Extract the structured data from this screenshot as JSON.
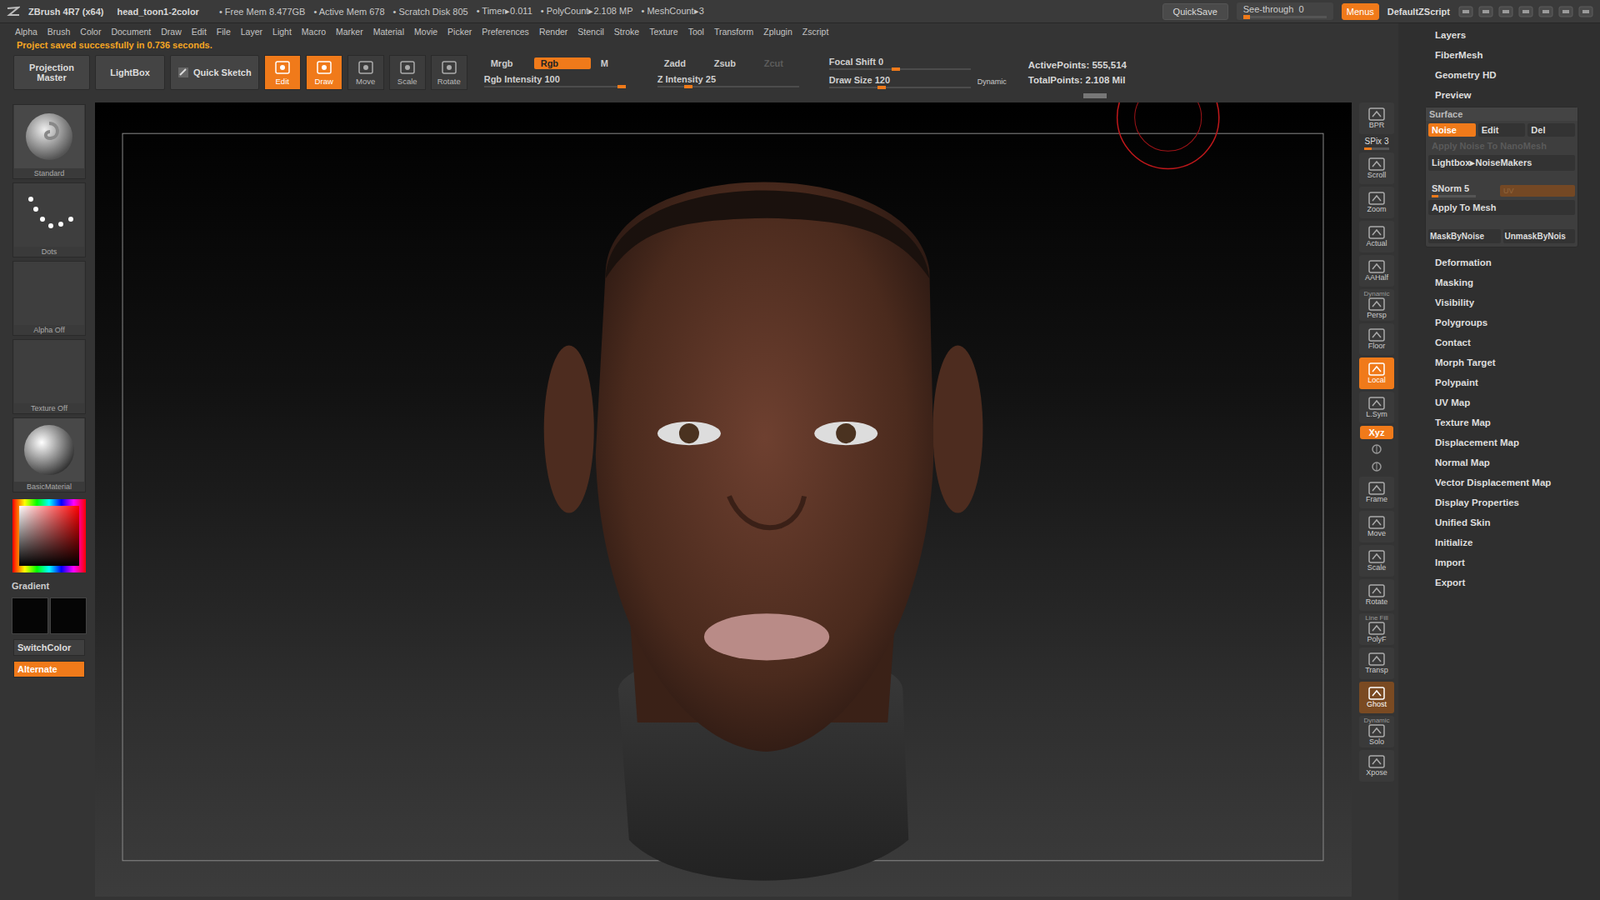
{
  "title_bar": {
    "app": "ZBrush 4R7 (x64)",
    "document": "head_toon1-2color",
    "stats": [
      "• Free Mem 8.477GB",
      "• Active Mem 678",
      "• Scratch Disk 805",
      "• Timer▸0.011",
      "• PolyCount▸2.108 MP",
      "• MeshCount▸3"
    ],
    "quicksave": "QuickSave",
    "see_through": {
      "label": "See-through",
      "value": "0",
      "level": 0
    },
    "menus": {
      "label": "Menus",
      "selected": true
    },
    "script": "DefaultZScript"
  },
  "menu_bar": [
    "Alpha",
    "Brush",
    "Color",
    "Document",
    "Draw",
    "Edit",
    "File",
    "Layer",
    "Light",
    "Macro",
    "Marker",
    "Material",
    "Movie",
    "Picker",
    "Preferences",
    "Render",
    "Stencil",
    "Stroke",
    "Texture",
    "Tool",
    "Transform",
    "Zplugin",
    "Zscript"
  ],
  "status": "Project saved successfully in 0.736 seconds.",
  "shelf": {
    "panels": [
      {
        "label": "Projection Master",
        "selected": false
      },
      {
        "label": "LightBox",
        "selected": false
      },
      {
        "label": "Quick Sketch",
        "selected": false
      }
    ],
    "tools": [
      {
        "label": "Edit",
        "selected": true
      },
      {
        "label": "Draw",
        "selected": true
      },
      {
        "label": "Move",
        "selected": false
      },
      {
        "label": "Scale",
        "selected": false
      },
      {
        "label": "Rotate",
        "selected": false
      }
    ],
    "color_modes": [
      {
        "label": "Mrgb",
        "selected": false
      },
      {
        "label": "Rgb",
        "selected": true
      },
      {
        "label": "M",
        "selected": false
      }
    ],
    "z_modes": [
      {
        "label": "Zadd",
        "selected": false,
        "disabled": false
      },
      {
        "label": "Zsub",
        "selected": false,
        "disabled": false
      },
      {
        "label": "Zcut",
        "selected": false,
        "disabled": true
      }
    ],
    "rgb_intensity": {
      "label": "Rgb Intensity",
      "value": "100",
      "level": 1
    },
    "z_intensity": {
      "label": "Z Intensity",
      "value": "25",
      "level": 0.25
    },
    "focal_shift": {
      "label": "Focal Shift",
      "value": "0",
      "level": 0.5
    },
    "draw_size": {
      "label": "Draw Size",
      "value": "120",
      "level": 0.4
    },
    "dynamic": "Dynamic",
    "active_points": "ActivePoints: 555,514",
    "total_points": "TotalPoints: 2.108 Mil"
  },
  "left_shelf": {
    "thumbs": [
      {
        "label": "Standard",
        "kind": "brush"
      },
      {
        "label": "Dots",
        "kind": "stroke"
      },
      {
        "label": "Alpha  Off",
        "kind": "alpha"
      },
      {
        "label": "Texture  Off",
        "kind": "texture"
      },
      {
        "label": "BasicMaterial",
        "kind": "material"
      }
    ],
    "gradient": "Gradient",
    "switch_color": {
      "label": "SwitchColor",
      "selected": false
    },
    "alternate": {
      "label": "Alternate",
      "selected": true
    }
  },
  "right_shelf": [
    {
      "label": "BPR",
      "caption": "",
      "kind": "button",
      "selected": false,
      "disabled": false
    },
    {
      "label": "SPix 3",
      "caption": "",
      "kind": "slider",
      "level": 0.3,
      "selected": false,
      "disabled": false
    },
    {
      "label": "Scroll",
      "caption": "",
      "kind": "button",
      "selected": false,
      "disabled": false
    },
    {
      "label": "Zoom",
      "caption": "",
      "kind": "button",
      "selected": false,
      "disabled": false
    },
    {
      "label": "Actual",
      "caption": "",
      "kind": "button",
      "selected": false,
      "disabled": false
    },
    {
      "label": "AAHalf",
      "caption": "",
      "kind": "button",
      "selected": false,
      "disabled": false
    },
    {
      "label": "Persp",
      "caption": "Dynamic",
      "kind": "button",
      "selected": false,
      "disabled": false
    },
    {
      "label": "Floor",
      "caption": "",
      "kind": "button",
      "selected": false,
      "disabled": false
    },
    {
      "label": "Local",
      "caption": "",
      "kind": "button",
      "selected": true,
      "disabled": false
    },
    {
      "label": "L.Sym",
      "caption": "",
      "kind": "button",
      "selected": false,
      "disabled": false
    },
    {
      "label": "Xyz",
      "caption": "",
      "kind": "toggle",
      "selected": true,
      "disabled": false
    },
    {
      "label": "",
      "caption": "",
      "kind": "mini",
      "selected": false,
      "disabled": false
    },
    {
      "label": "",
      "caption": "",
      "kind": "mini",
      "selected": false,
      "disabled": false
    },
    {
      "label": "Frame",
      "caption": "",
      "kind": "button",
      "selected": false,
      "disabled": false
    },
    {
      "label": "Move",
      "caption": "",
      "kind": "button",
      "selected": false,
      "disabled": false
    },
    {
      "label": "Scale",
      "caption": "",
      "kind": "button",
      "selected": false,
      "disabled": false
    },
    {
      "label": "Rotate",
      "caption": "",
      "kind": "button",
      "selected": false,
      "disabled": false
    },
    {
      "label": "PolyF",
      "caption": "Line Fill",
      "kind": "button",
      "selected": false,
      "disabled": false
    },
    {
      "label": "Transp",
      "caption": "",
      "kind": "button",
      "selected": false,
      "disabled": false
    },
    {
      "label": "Ghost",
      "caption": "",
      "kind": "button",
      "selected": true,
      "disabled": true
    },
    {
      "label": "Solo",
      "caption": "Dynamic",
      "kind": "button",
      "selected": false,
      "disabled": false
    },
    {
      "label": "Xpose",
      "caption": "",
      "kind": "button",
      "selected": false,
      "disabled": false
    }
  ],
  "tray": {
    "top_items": [
      "Layers",
      "FiberMesh",
      "Geometry HD",
      "Preview"
    ],
    "surface": {
      "title": "Surface",
      "expanded": true,
      "tabs": [
        {
          "label": "Noise",
          "selected": true
        },
        {
          "label": "Edit",
          "selected": false
        },
        {
          "label": "Del",
          "selected": false
        }
      ],
      "apply_nano": {
        "label": "Apply Noise To NanoMesh",
        "disabled": true
      },
      "noisemakers": "Lightbox▸NoiseMakers",
      "snorm": {
        "label": "SNorm 5",
        "level": 0.15
      },
      "uv": {
        "label": "UV",
        "disabled": true
      },
      "apply_mesh": "Apply To Mesh",
      "mask_buttons": [
        "MaskByNoise",
        "UnmaskByNois"
      ]
    },
    "items": [
      "Deformation",
      "Masking",
      "Visibility",
      "Polygroups",
      "Contact",
      "Morph Target",
      "Polypaint",
      "UV Map",
      "Texture Map",
      "Displacement Map",
      "Normal Map",
      "Vector Displacement Map",
      "Display Properties",
      "Unified Skin",
      "Initialize",
      "Import",
      "Export"
    ]
  }
}
